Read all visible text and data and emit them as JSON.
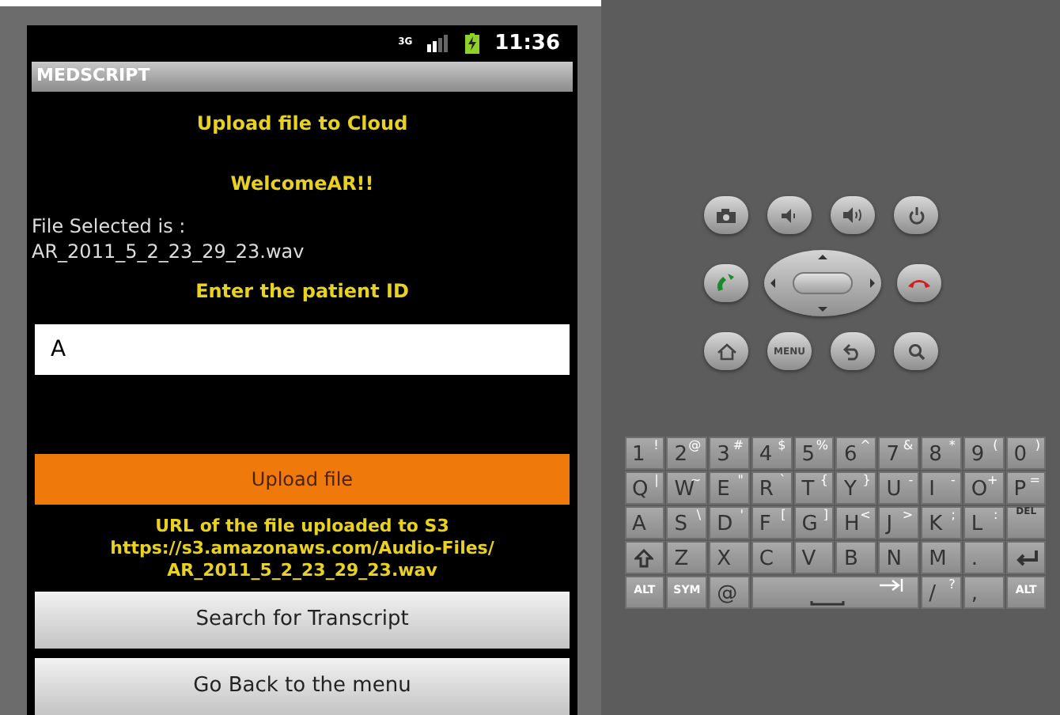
{
  "status_bar": {
    "network": "3G",
    "time": "11:36"
  },
  "app_title": "MEDSCRIPT",
  "heading": "Upload file to Cloud",
  "welcome": "WelcomeAR!!",
  "file_label": "File Selected is :",
  "file_name": "AR_2011_5_2_23_29_23.wav",
  "patient_label": "Enter the patient ID",
  "patient_field": {
    "value": "A"
  },
  "upload_button": "Upload file",
  "url_label": "URL of the file uploaded to S3",
  "url_lines": [
    "https://s3.amazonaws.com/Audio-Files/",
    "AR_2011_5_2_23_29_23.wav"
  ],
  "buttons": [
    "Search for Transcript",
    "Go Back to the menu"
  ],
  "menu_key": "MENU",
  "keyboard": [
    [
      {
        "kind": "char",
        "main": "1",
        "alt": "!"
      },
      {
        "kind": "char",
        "main": "2",
        "alt": "@"
      },
      {
        "kind": "char",
        "main": "3",
        "alt": "#"
      },
      {
        "kind": "char",
        "main": "4",
        "alt": "$"
      },
      {
        "kind": "char",
        "main": "5",
        "alt": "%"
      },
      {
        "kind": "char",
        "main": "6",
        "alt": "^"
      },
      {
        "kind": "char",
        "main": "7",
        "alt": "&"
      },
      {
        "kind": "char",
        "main": "8",
        "alt": "*"
      },
      {
        "kind": "char",
        "main": "9",
        "alt": "("
      },
      {
        "kind": "char",
        "main": "0",
        "alt": ")"
      }
    ],
    [
      {
        "kind": "char",
        "main": "Q",
        "alt": "|"
      },
      {
        "kind": "char",
        "main": "W",
        "alt": "~"
      },
      {
        "kind": "char",
        "main": "E",
        "alt": "\""
      },
      {
        "kind": "char",
        "main": "R",
        "alt": "`"
      },
      {
        "kind": "char",
        "main": "T",
        "alt": "{"
      },
      {
        "kind": "char",
        "main": "Y",
        "alt": "}"
      },
      {
        "kind": "char",
        "main": "U",
        "alt": "-"
      },
      {
        "kind": "char",
        "main": "I",
        "alt": "-"
      },
      {
        "kind": "char",
        "main": "O",
        "alt": "+"
      },
      {
        "kind": "char",
        "main": "P",
        "alt": "="
      }
    ],
    [
      {
        "kind": "char",
        "main": "A"
      },
      {
        "kind": "char",
        "main": "S",
        "alt": "\\"
      },
      {
        "kind": "char",
        "main": "D",
        "alt": "'"
      },
      {
        "kind": "char",
        "main": "F",
        "alt": "["
      },
      {
        "kind": "char",
        "main": "G",
        "alt": "]"
      },
      {
        "kind": "char",
        "main": "H",
        "alt": "<"
      },
      {
        "kind": "char",
        "main": "J",
        "alt": ">"
      },
      {
        "kind": "char",
        "main": "K",
        "alt": ";"
      },
      {
        "kind": "char",
        "main": "L",
        "alt": ":"
      },
      {
        "kind": "del",
        "main": "DEL"
      }
    ],
    [
      {
        "kind": "shift"
      },
      {
        "kind": "char",
        "main": "Z"
      },
      {
        "kind": "char",
        "main": "X"
      },
      {
        "kind": "char",
        "main": "C"
      },
      {
        "kind": "char",
        "main": "V"
      },
      {
        "kind": "char",
        "main": "B"
      },
      {
        "kind": "char",
        "main": "N"
      },
      {
        "kind": "char",
        "main": "M"
      },
      {
        "kind": "char",
        "main": "."
      },
      {
        "kind": "enter"
      }
    ],
    [
      {
        "kind": "small",
        "main": "ALT"
      },
      {
        "kind": "small",
        "main": "SYM"
      },
      {
        "kind": "char",
        "main": "@"
      },
      {
        "kind": "space"
      },
      {
        "kind": "char",
        "main": "/",
        "alt": "?"
      },
      {
        "kind": "char",
        "main": ","
      },
      {
        "kind": "small",
        "main": "ALT"
      }
    ]
  ]
}
